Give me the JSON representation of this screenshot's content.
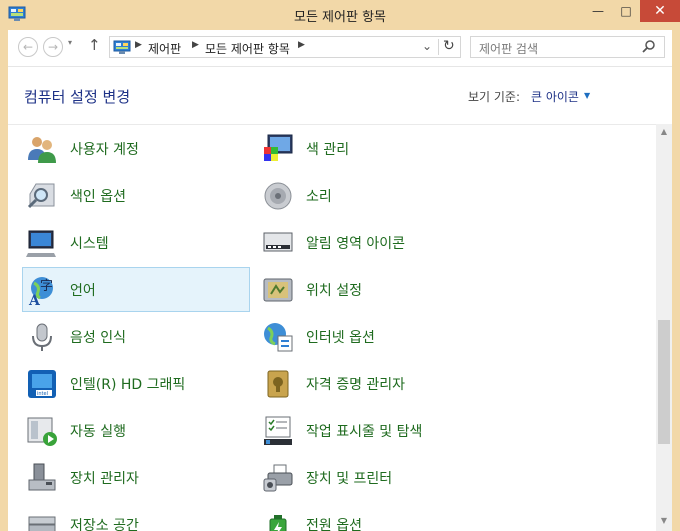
{
  "window": {
    "title": "모든 제어판 항목",
    "minimize_glyph": "—",
    "maximize_glyph": "□",
    "close_glyph": "✕"
  },
  "nav": {
    "back_glyph": "←",
    "forward_glyph": "→",
    "recent_glyph": "▾",
    "up_glyph": "↑"
  },
  "address": {
    "segments": [
      "제어판",
      "모든 제어판 항목"
    ],
    "chevron": "▶",
    "dropdown_glyph": "⌄",
    "refresh_glyph": "↻"
  },
  "search": {
    "placeholder": "제어판 검색",
    "icon": "search-icon"
  },
  "header": {
    "title": "컴퓨터 설정 변경",
    "view_by_label": "보기 기준:",
    "view_by_value": "큰 아이콘",
    "view_by_caret": "▼"
  },
  "items": [
    {
      "label": "사용자 계정",
      "icon": "user-accounts-icon"
    },
    {
      "label": "색 관리",
      "icon": "color-management-icon"
    },
    {
      "label": "색인 옵션",
      "icon": "indexing-options-icon"
    },
    {
      "label": "소리",
      "icon": "sound-icon"
    },
    {
      "label": "시스템",
      "icon": "system-icon"
    },
    {
      "label": "알림 영역 아이콘",
      "icon": "notification-area-icon"
    },
    {
      "label": "언어",
      "icon": "language-icon",
      "selected": true
    },
    {
      "label": "위치 설정",
      "icon": "location-settings-icon"
    },
    {
      "label": "음성 인식",
      "icon": "microphone-icon"
    },
    {
      "label": "인터넷 옵션",
      "icon": "internet-options-icon"
    },
    {
      "label": "인텔(R) HD 그래픽",
      "icon": "intel-graphics-icon"
    },
    {
      "label": "자격 증명 관리자",
      "icon": "credential-manager-icon"
    },
    {
      "label": "자동 실행",
      "icon": "autoplay-icon"
    },
    {
      "label": "작업 표시줄 및 탐색",
      "icon": "taskbar-icon"
    },
    {
      "label": "장치 관리자",
      "icon": "device-manager-icon"
    },
    {
      "label": "장치 및 프린터",
      "icon": "devices-printers-icon"
    },
    {
      "label": "저장소 공간",
      "icon": "storage-spaces-icon"
    },
    {
      "label": "전원 옵션",
      "icon": "power-options-icon"
    }
  ],
  "scrollbar": {
    "up_glyph": "▲",
    "down_glyph": "▼"
  },
  "colors": {
    "frame": "#f2d8a8",
    "close_button": "#c74a38",
    "title_link": "#1e3287",
    "item_label": "#1f6b1f",
    "selection_bg": "#e5f3fb",
    "selection_border": "#a9d4ee"
  }
}
